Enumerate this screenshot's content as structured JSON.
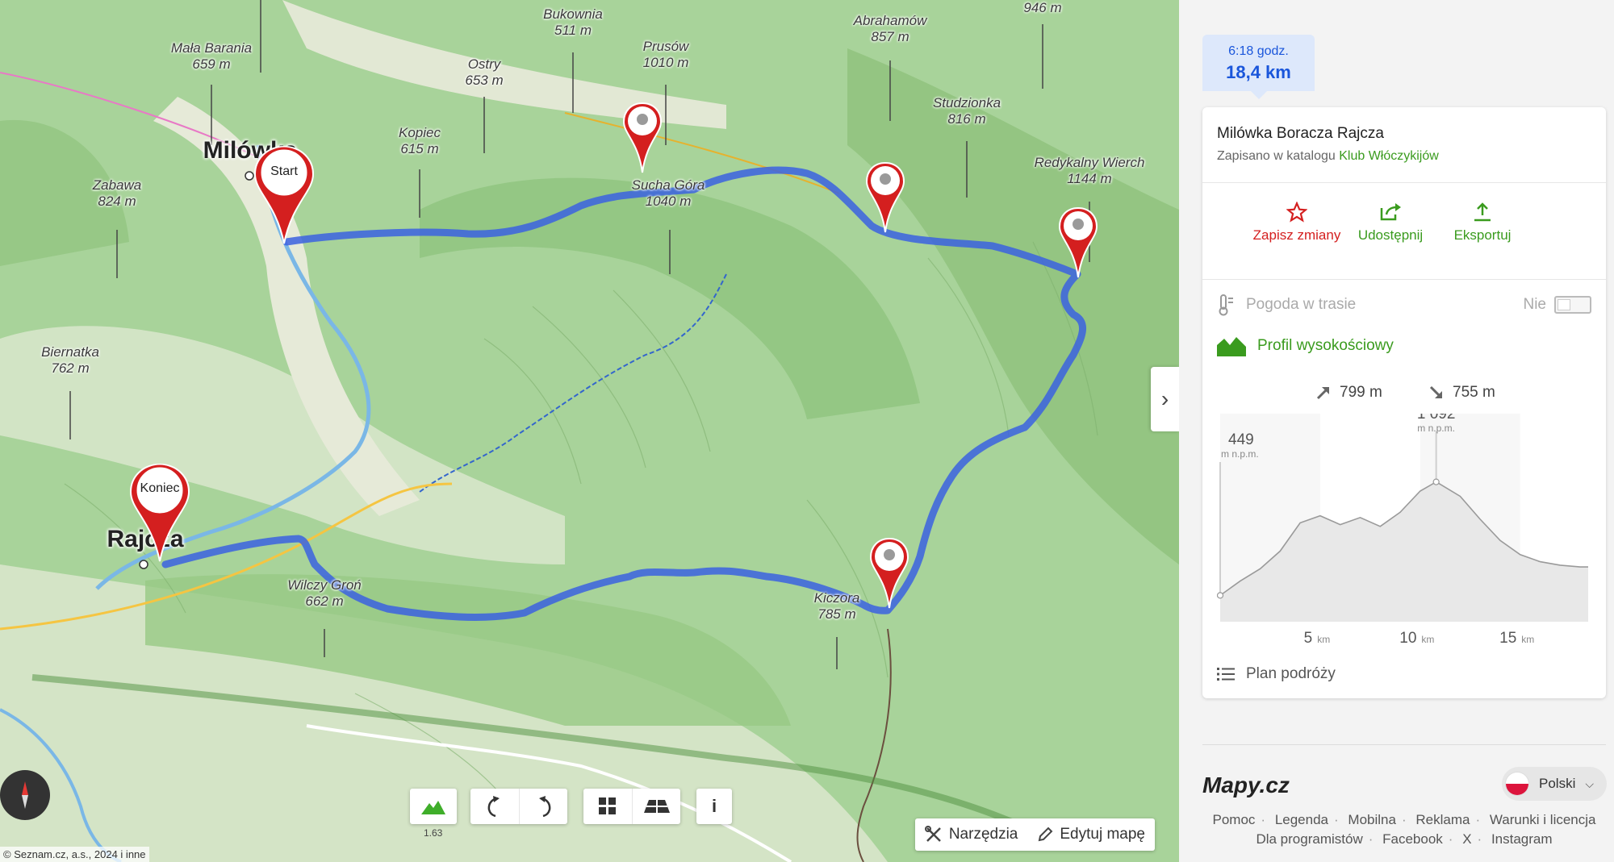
{
  "map": {
    "peaks": [
      {
        "name": "Bukownia",
        "elev": "511 m"
      },
      {
        "name": "Abrahamów",
        "elev": "857 m"
      },
      {
        "name": "",
        "elev": "946 m"
      },
      {
        "name": "Mała Barania",
        "elev": "659 m"
      },
      {
        "name": "Ostry",
        "elev": "653 m"
      },
      {
        "name": "Prusów",
        "elev": "1010 m"
      },
      {
        "name": "Kopiec",
        "elev": "615 m"
      },
      {
        "name": "Studzionka",
        "elev": "816 m"
      },
      {
        "name": "Redykalny Wierch",
        "elev": "1144 m"
      },
      {
        "name": "Zabawa",
        "elev": "824 m"
      },
      {
        "name": "Sucha Góra",
        "elev": "1040 m"
      },
      {
        "name": "Biernatka",
        "elev": "762 m"
      },
      {
        "name": "Wilczy Groń",
        "elev": "662 m"
      },
      {
        "name": "Kiczora",
        "elev": "785 m"
      }
    ],
    "towns": {
      "milowka": "Milówka",
      "rajcza": "Rajcza"
    },
    "pins": {
      "start": "Start",
      "end": "Koniec"
    },
    "zoom_level": "1.63",
    "copyright": "© Seznam.cz, a.s., 2024 i inne",
    "tools": {
      "tools_label": "Narzędzia",
      "edit_label": "Edytuj mapę"
    },
    "route_color": "#4a6fe0"
  },
  "panel": {
    "route_summary": {
      "duration": "6:18 godz.",
      "distance": "18,4 km"
    },
    "route_title": "Milówka Boracza Rajcza",
    "catalog_prefix": "Zapisano w katalogu",
    "catalog_name": "Klub Włóczykijów",
    "actions": {
      "save": "Zapisz zmiany",
      "share": "Udostępnij",
      "export": "Eksportuj"
    },
    "weather": {
      "label": "Pogoda w trasie",
      "toggle_value": "Nie"
    },
    "elevation": {
      "label": "Profil wysokościowy",
      "ascent": "799 m",
      "descent": "755 m",
      "start_elev": "449",
      "max_elev": "1 092",
      "unit": "m n.p.m.",
      "km_ticks": [
        {
          "value": "5",
          "unit": "km"
        },
        {
          "value": "10",
          "unit": "km"
        },
        {
          "value": "15",
          "unit": "km"
        }
      ]
    },
    "plan_label": "Plan podróży"
  },
  "footer": {
    "logo": "Mapy.cz",
    "language": "Polski",
    "links": [
      "Pomoc",
      "Legenda",
      "Mobilna",
      "Reklama",
      "Warunki i licencja",
      "Dla programistów",
      "Facebook",
      "X",
      "Instagram"
    ]
  },
  "chart_data": {
    "type": "area",
    "title": "Profil wysokościowy",
    "xlabel": "km",
    "ylabel": "m n.p.m.",
    "x": [
      0,
      1,
      2,
      3,
      4,
      5,
      6,
      7,
      8,
      9,
      10,
      10.8,
      12,
      13,
      14,
      15,
      16,
      17,
      18,
      18.4
    ],
    "values": [
      449,
      530,
      600,
      700,
      860,
      900,
      850,
      890,
      840,
      920,
      1040,
      1092,
      1010,
      880,
      760,
      680,
      640,
      620,
      610,
      610
    ],
    "xlim": [
      0,
      18.4
    ],
    "ylim": [
      300,
      1250
    ]
  }
}
